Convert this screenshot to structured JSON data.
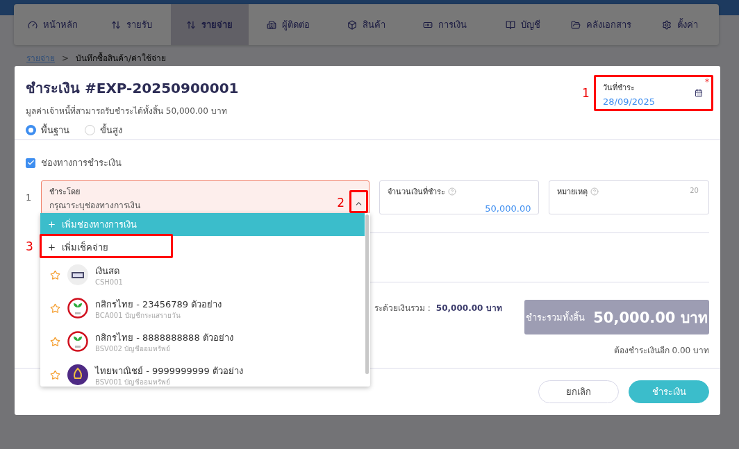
{
  "nav": [
    {
      "label": "หน้าหลัก",
      "selected": false
    },
    {
      "label": "รายรับ",
      "selected": false
    },
    {
      "label": "รายจ่าย",
      "selected": true
    },
    {
      "label": "ผู้ติดต่อ",
      "selected": false
    },
    {
      "label": "สินค้า",
      "selected": false
    },
    {
      "label": "การเงิน",
      "selected": false
    },
    {
      "label": "บัญชี",
      "selected": false
    },
    {
      "label": "คลังเอกสาร",
      "selected": false
    },
    {
      "label": "ตั้งค่า",
      "selected": false
    }
  ],
  "breadcrumb": [
    {
      "label": "รายจ่าย",
      "kind": "link"
    },
    {
      "label": ">",
      "kind": "separator"
    },
    {
      "label": "บันทึกซื้อสินค้า/ค่าใช้จ่าย",
      "kind": "current"
    }
  ],
  "dialog": {
    "title": "ชำระเงิน #EXP-20250900001",
    "subtitle": "มูลค่าเจ้าหนี้ที่สามารถรับชำระได้ทั้งสิ้น 50,000.00 บาท",
    "modes": [
      {
        "label": "พื้นฐาน",
        "selected": true
      },
      {
        "label": "ขั้นสูง",
        "selected": false
      }
    ],
    "date_field": {
      "label": "วันที่ชำระ",
      "value": "28/09/2025",
      "required_mark": "*",
      "annotation": "1"
    },
    "channel_toggle": {
      "label": "ช่องทางการชำระเงิน",
      "checked": true
    },
    "payment_row": {
      "number": "1",
      "pay_by": {
        "label": "ชำระโดย",
        "placeholder": "กรุณาระบุช่องทางการเงิน",
        "error": true,
        "annotation": "2"
      },
      "amount": {
        "label": "จำนวนเงินที่ชำระ",
        "value": "50,000.00"
      },
      "note": {
        "label": "หมายเหตุ",
        "counter": "20"
      }
    },
    "dropdown": {
      "add_channel": "เพิ่มช่องทางการเงิน",
      "add_cheque": {
        "label": "เพิ่มเช็คจ่าย",
        "annotation": "3"
      },
      "options": [
        {
          "name": "เงินสด",
          "code": "CSH001",
          "kind": "cash"
        },
        {
          "name": "กสิกรไทย - 23456789 ตัวอย่าง",
          "code": "BCA001 บัญชีกระแสรายวัน",
          "kind": "kbank"
        },
        {
          "name": "กสิกรไทย - 8888888888 ตัวอย่าง",
          "code": "BSV002 บัญชีออมทรัพย์",
          "kind": "kbank"
        },
        {
          "name": "ไทยพาณิชย์ - 9999999999 ตัวอย่าง",
          "code": "BSV001 บัญชีออมทรัพย์",
          "kind": "scb"
        }
      ]
    },
    "summary": {
      "label": "ระด้วยเงินรวม :",
      "value": "50,000.00 บาท"
    },
    "total": {
      "label": "ชำระรวมทั้งสิ้น",
      "value": "50,000.00 บาท"
    },
    "remaining": "ต้องชำระเงินอีก 0.00 บาท",
    "buttons": [
      {
        "label": "ยกเลิก",
        "kind": "secondary"
      },
      {
        "label": "ชำระเงิน",
        "kind": "primary"
      }
    ]
  }
}
